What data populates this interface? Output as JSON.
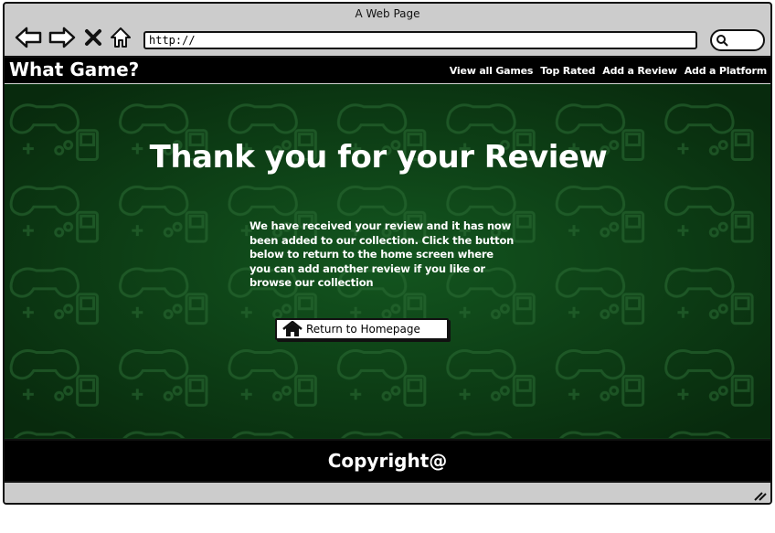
{
  "browser": {
    "title": "A Web Page",
    "url": "http://"
  },
  "site": {
    "brand": "What Game?",
    "nav": [
      "View all Games",
      "Top Rated",
      "Add a Review",
      "Add a Platform"
    ]
  },
  "main": {
    "heading": "Thank you for your Review",
    "message": "We have received your review and it has now been added to our collection. Click the button below to return to the home screen where you can add another review if you like or browse our collection",
    "button_label": "Return to Homepage"
  },
  "footer": {
    "copyright": "Copyright@"
  },
  "colors": {
    "background_green": "#0c3a14",
    "bar_black": "#000000",
    "chrome_gray": "#cccccc"
  }
}
